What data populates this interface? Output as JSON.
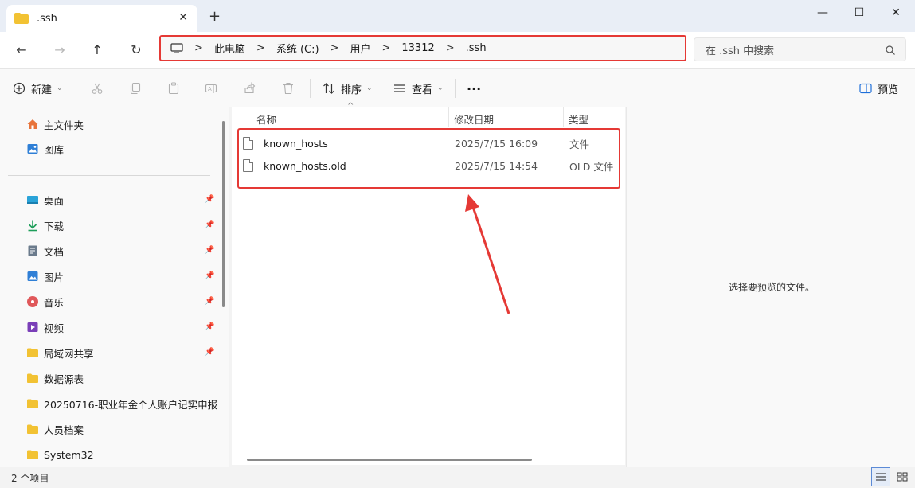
{
  "tab": {
    "title": ".ssh",
    "close": "✕",
    "new_tab": "+"
  },
  "window": {
    "minimize": "—",
    "maximize": "☐",
    "close": "✕"
  },
  "nav": {
    "back": "←",
    "forward": "→",
    "up": "↑",
    "refresh": "↻"
  },
  "breadcrumb": {
    "items": [
      "此电脑",
      "系统 (C:)",
      "用户",
      "13312",
      ".ssh"
    ],
    "separator": ">"
  },
  "search": {
    "placeholder": "在 .ssh 中搜索"
  },
  "toolbar": {
    "new_label": "新建",
    "sort_label": "排序",
    "view_label": "查看",
    "more_label": "···",
    "preview_label": "预览"
  },
  "sidebar": {
    "top_items": [
      {
        "label": "主文件夹",
        "icon": "home-icon"
      },
      {
        "label": "图库",
        "icon": "gallery-icon"
      }
    ],
    "pinned_items": [
      {
        "label": "桌面",
        "icon": "desktop-icon",
        "pinned": true
      },
      {
        "label": "下载",
        "icon": "download-icon",
        "pinned": true
      },
      {
        "label": "文档",
        "icon": "document-icon",
        "pinned": true
      },
      {
        "label": "图片",
        "icon": "pictures-icon",
        "pinned": true
      },
      {
        "label": "音乐",
        "icon": "music-icon",
        "pinned": true
      },
      {
        "label": "视频",
        "icon": "video-icon",
        "pinned": true
      },
      {
        "label": "局域网共享",
        "icon": "shared-folder-icon",
        "pinned": true
      },
      {
        "label": "数据源表",
        "icon": "folder-icon",
        "pinned": false
      },
      {
        "label": "20250716-职业年金个人账户记实申报",
        "icon": "folder-icon",
        "pinned": false
      },
      {
        "label": "人员档案",
        "icon": "folder-icon",
        "pinned": false
      },
      {
        "label": "System32",
        "icon": "folder-icon",
        "pinned": false
      }
    ]
  },
  "columns": {
    "name": "名称",
    "modified": "修改日期",
    "type": "类型"
  },
  "files": [
    {
      "name": "known_hosts",
      "modified": "2025/7/15 16:09",
      "type": "文件"
    },
    {
      "name": "known_hosts.old",
      "modified": "2025/7/15 14:54",
      "type": "OLD 文件"
    }
  ],
  "preview": {
    "message": "选择要预览的文件。"
  },
  "status": {
    "count": "2 个项目"
  },
  "colors": {
    "annotation_red": "#e53935",
    "folder_yellow": "#f2c233",
    "accent_blue": "#1e6fd9"
  }
}
